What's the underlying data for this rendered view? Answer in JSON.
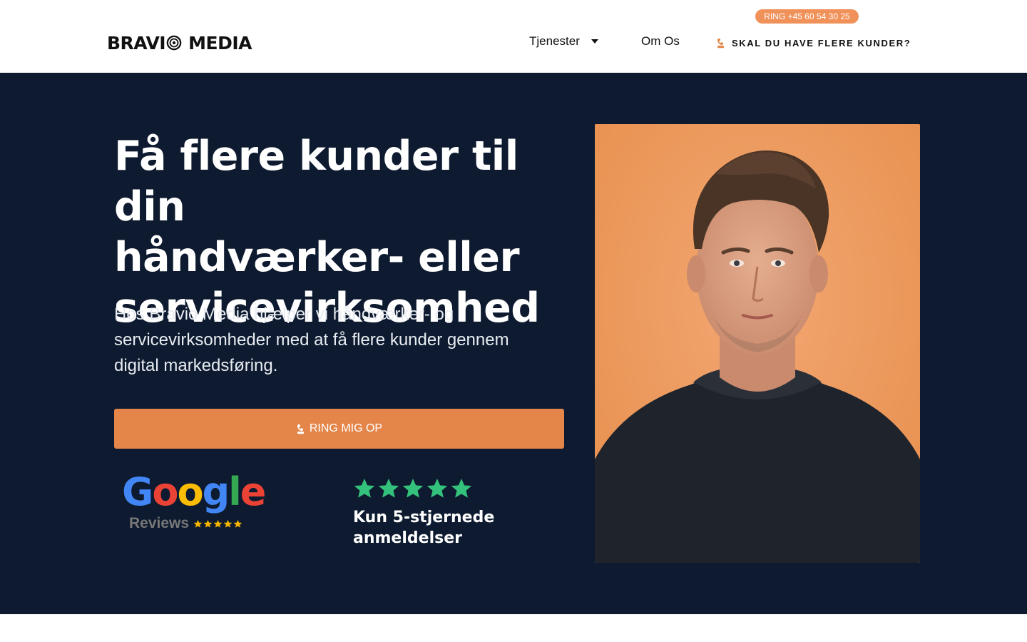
{
  "header": {
    "logo_text_left": "BRAVI",
    "logo_text_right": "MEDIA",
    "phone_badge": "RING +45 60 54 30 25",
    "nav": {
      "services_label": "Tjenester",
      "about_label": "Om Os",
      "cta_label": "SKAL DU HAVE FLERE KUNDER?"
    }
  },
  "hero": {
    "title_line1": "Få flere kunder til din",
    "title_line2": "håndværker- eller",
    "title_line3": "servicevirksomhed",
    "subtitle_line1": "Hos Bravio Media hjælper vi håndværker- og",
    "subtitle_line2": "servicevirksomheder med at få flere kunder gennem",
    "subtitle_line3": "digital markedsføring.",
    "cta_button": "RING MIG OP",
    "google_letters": [
      "G",
      "o",
      "o",
      "g",
      "l",
      "e"
    ],
    "google_reviews_label": "Reviews",
    "rating_stars": 5,
    "rating_text_line1": "Kun 5-stjernede",
    "rating_text_line2": "anmeldelser"
  },
  "colors": {
    "hero_bg": "#0d1a2f",
    "accent_orange": "#e4864a",
    "badge_orange": "#f0915a",
    "star_green": "#34c17b",
    "star_gold": "#f4b400"
  },
  "icons": [
    "handset-icon",
    "chevron-down-icon",
    "star-icon"
  ]
}
